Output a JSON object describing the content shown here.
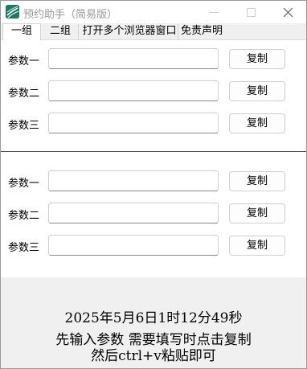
{
  "window": {
    "title": "预约助手（简易版）"
  },
  "tabs": [
    {
      "label": "一组",
      "active": true
    },
    {
      "label": "二组",
      "active": false
    },
    {
      "label": "打开多个浏览器窗口",
      "active": false
    },
    {
      "label": "免责声明",
      "active": false
    }
  ],
  "group_top": {
    "rows": [
      {
        "label": "参数一",
        "value": "",
        "button": "复制"
      },
      {
        "label": "参数二",
        "value": "",
        "button": "复制"
      },
      {
        "label": "参数三",
        "value": "",
        "button": "复制"
      }
    ]
  },
  "group_bottom": {
    "rows": [
      {
        "label": "参数一",
        "value": "",
        "button": "复制"
      },
      {
        "label": "参数二",
        "value": "",
        "button": "复制"
      },
      {
        "label": "参数三",
        "value": "",
        "button": "复制"
      }
    ]
  },
  "footer": {
    "datetime": "2025年5月6日1时12分49秒",
    "hint_line1": "先输入参数 需要填写时点击复制",
    "hint_line2": "然后ctrl+v粘贴即可"
  },
  "icons": {
    "app": "app-logo-icon",
    "minimize": "minimize-icon",
    "maximize": "maximize-icon",
    "close": "close-icon"
  }
}
